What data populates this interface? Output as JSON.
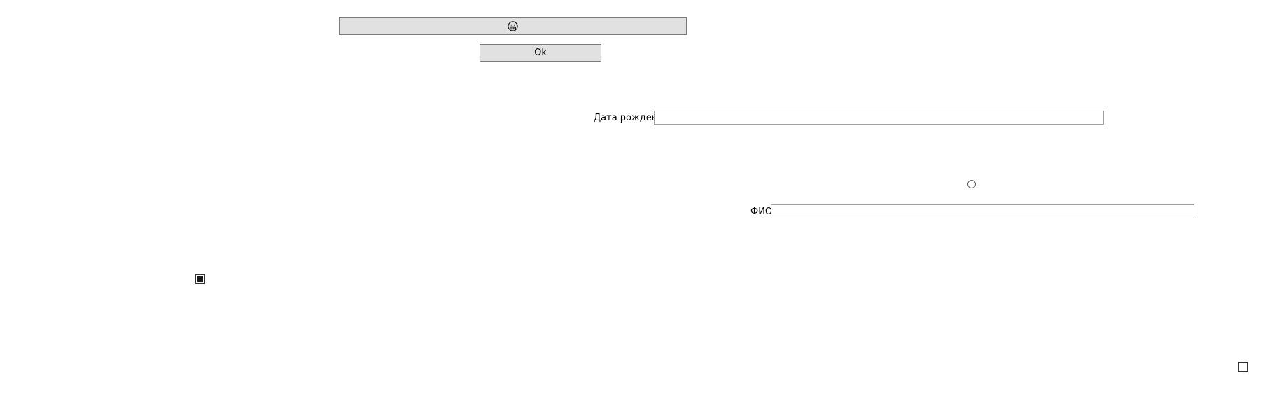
{
  "buttons": {
    "emoji_icon": "grimacing-face-icon",
    "ok_label": "Ok"
  },
  "form": {
    "birthdate_label": "Дата рождения",
    "birthdate_value": "",
    "fio_label": "ФИО",
    "fio_value": ""
  },
  "controls": {
    "radio_selected": false,
    "checkbox_1_checked": true,
    "checkbox_2_checked": false
  }
}
